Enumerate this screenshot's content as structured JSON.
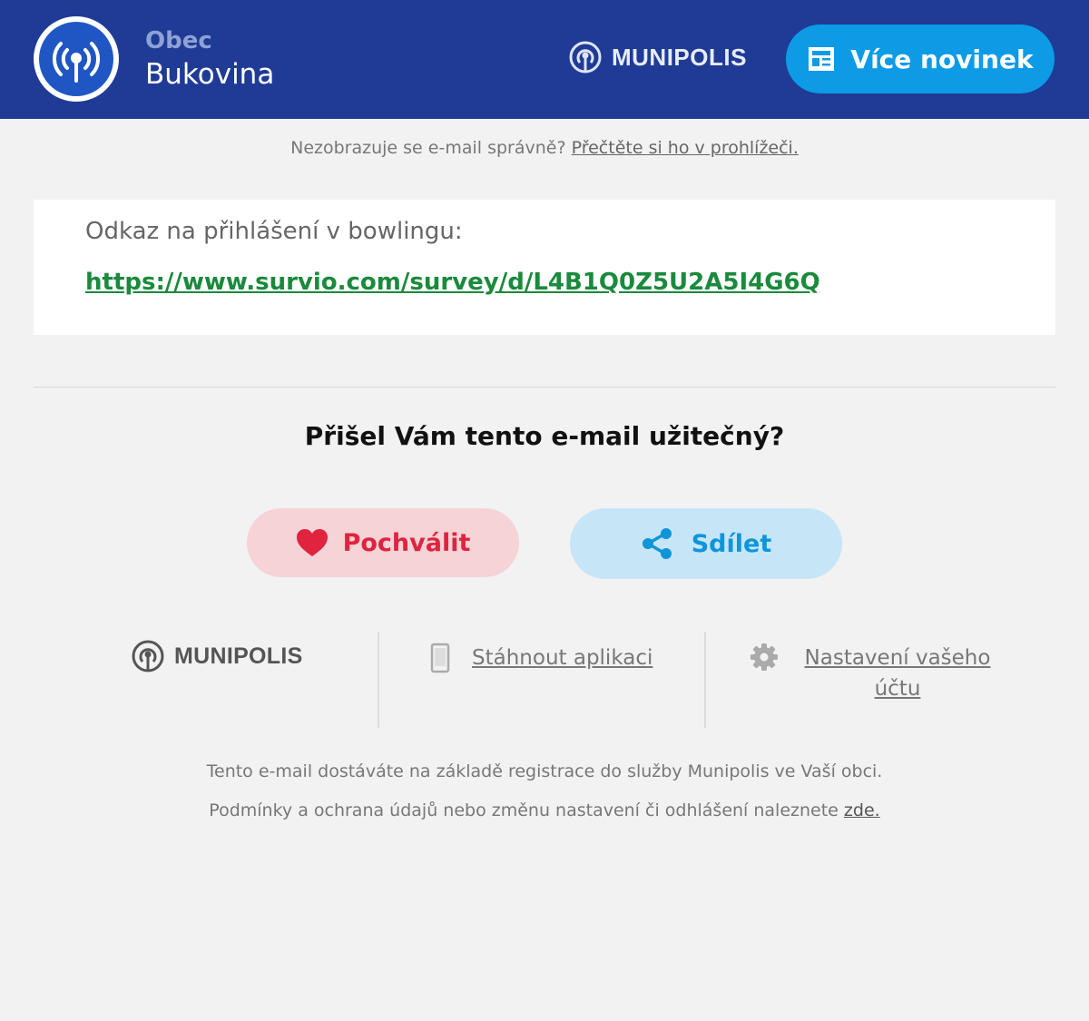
{
  "header": {
    "town_label": "Obec",
    "town_name": "Bukovina",
    "brand": "MUNIPOLIS",
    "more_news_label": "Více novinek",
    "colors": {
      "background": "#1f3b96",
      "button": "#0d9be6"
    },
    "icons": {
      "logo": "broadcast-antenna-icon",
      "more_news": "newspaper-icon"
    }
  },
  "browser_notice": {
    "text": "Nezobrazuje se e-mail správně?",
    "link_label": "Přečtěte si ho v prohlížeči."
  },
  "content": {
    "label": "Odkaz na přihlášení v bowlingu:",
    "link": "https://www.survio.com/survey/d/L4B1Q0Z5U2A5I4G6Q",
    "link_color": "#1a8a3c"
  },
  "feedback": {
    "question": "Přišel Vám tento e-mail užitečný?",
    "praise_label": "Pochválit",
    "share_label": "Sdílet",
    "icons": {
      "praise": "heart-icon",
      "share": "share-icon"
    },
    "colors": {
      "praise": "#e0233e",
      "share": "#0e95da"
    }
  },
  "footer": {
    "brand": "MUNIPOLIS",
    "app_link_label": "Stáhnout aplikaci",
    "settings_link_label": "Nastavení vašeho účtu",
    "icons": {
      "app": "smartphone-icon",
      "settings": "gear-icon"
    },
    "note_1": "Tento e-mail dostáváte na základě registrace do služby Munipolis ve Vaší obci.",
    "note_2": "Podmínky a ochrana údajů nebo změnu nastavení či odhlášení naleznete",
    "note_2_link": "zde."
  }
}
